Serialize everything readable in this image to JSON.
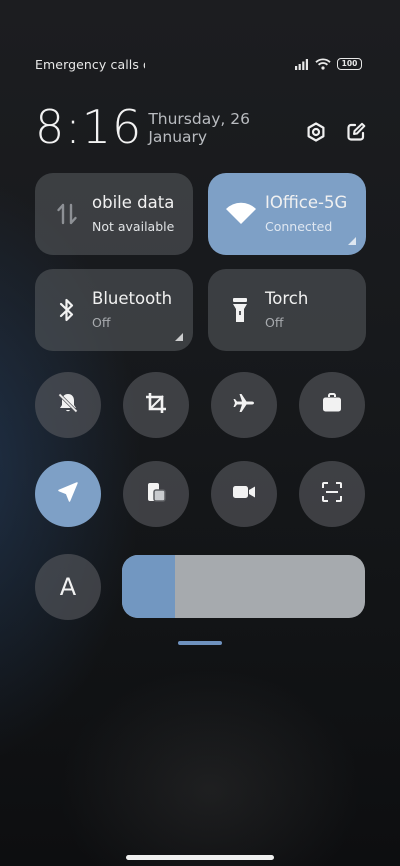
{
  "status": {
    "carrier_text": "Emergency calls o",
    "battery_level": "100",
    "icons": [
      "signal-icon",
      "wifi-icon",
      "battery-icon"
    ]
  },
  "header": {
    "time": "8:16",
    "date": "Thursday, 26 January",
    "icons": [
      "settings-icon",
      "edit-icon"
    ]
  },
  "tiles": {
    "mobile_data": {
      "title": "obile data",
      "subtitle": "Not available",
      "active": false
    },
    "wifi": {
      "title": "IOffice-5G",
      "subtitle": "Connected",
      "active": true
    },
    "bluetooth": {
      "title": "Bluetooth",
      "subtitle": "Off",
      "active": false
    },
    "torch": {
      "title": "Torch",
      "subtitle": "Off",
      "active": false
    }
  },
  "toggles": {
    "row1": [
      "mute-bell-icon",
      "crop-icon",
      "airplane-icon",
      "briefcase-icon"
    ],
    "row2": [
      "location-icon",
      "window-icon",
      "video-camera-icon",
      "scan-icon"
    ]
  },
  "font_button": {
    "label": "A"
  },
  "brightness": {
    "level": 0.22
  },
  "colors": {
    "accent": "#7ea0c6",
    "tile_inactive": "#4c4e52",
    "slider_track": "#a6aaae"
  }
}
